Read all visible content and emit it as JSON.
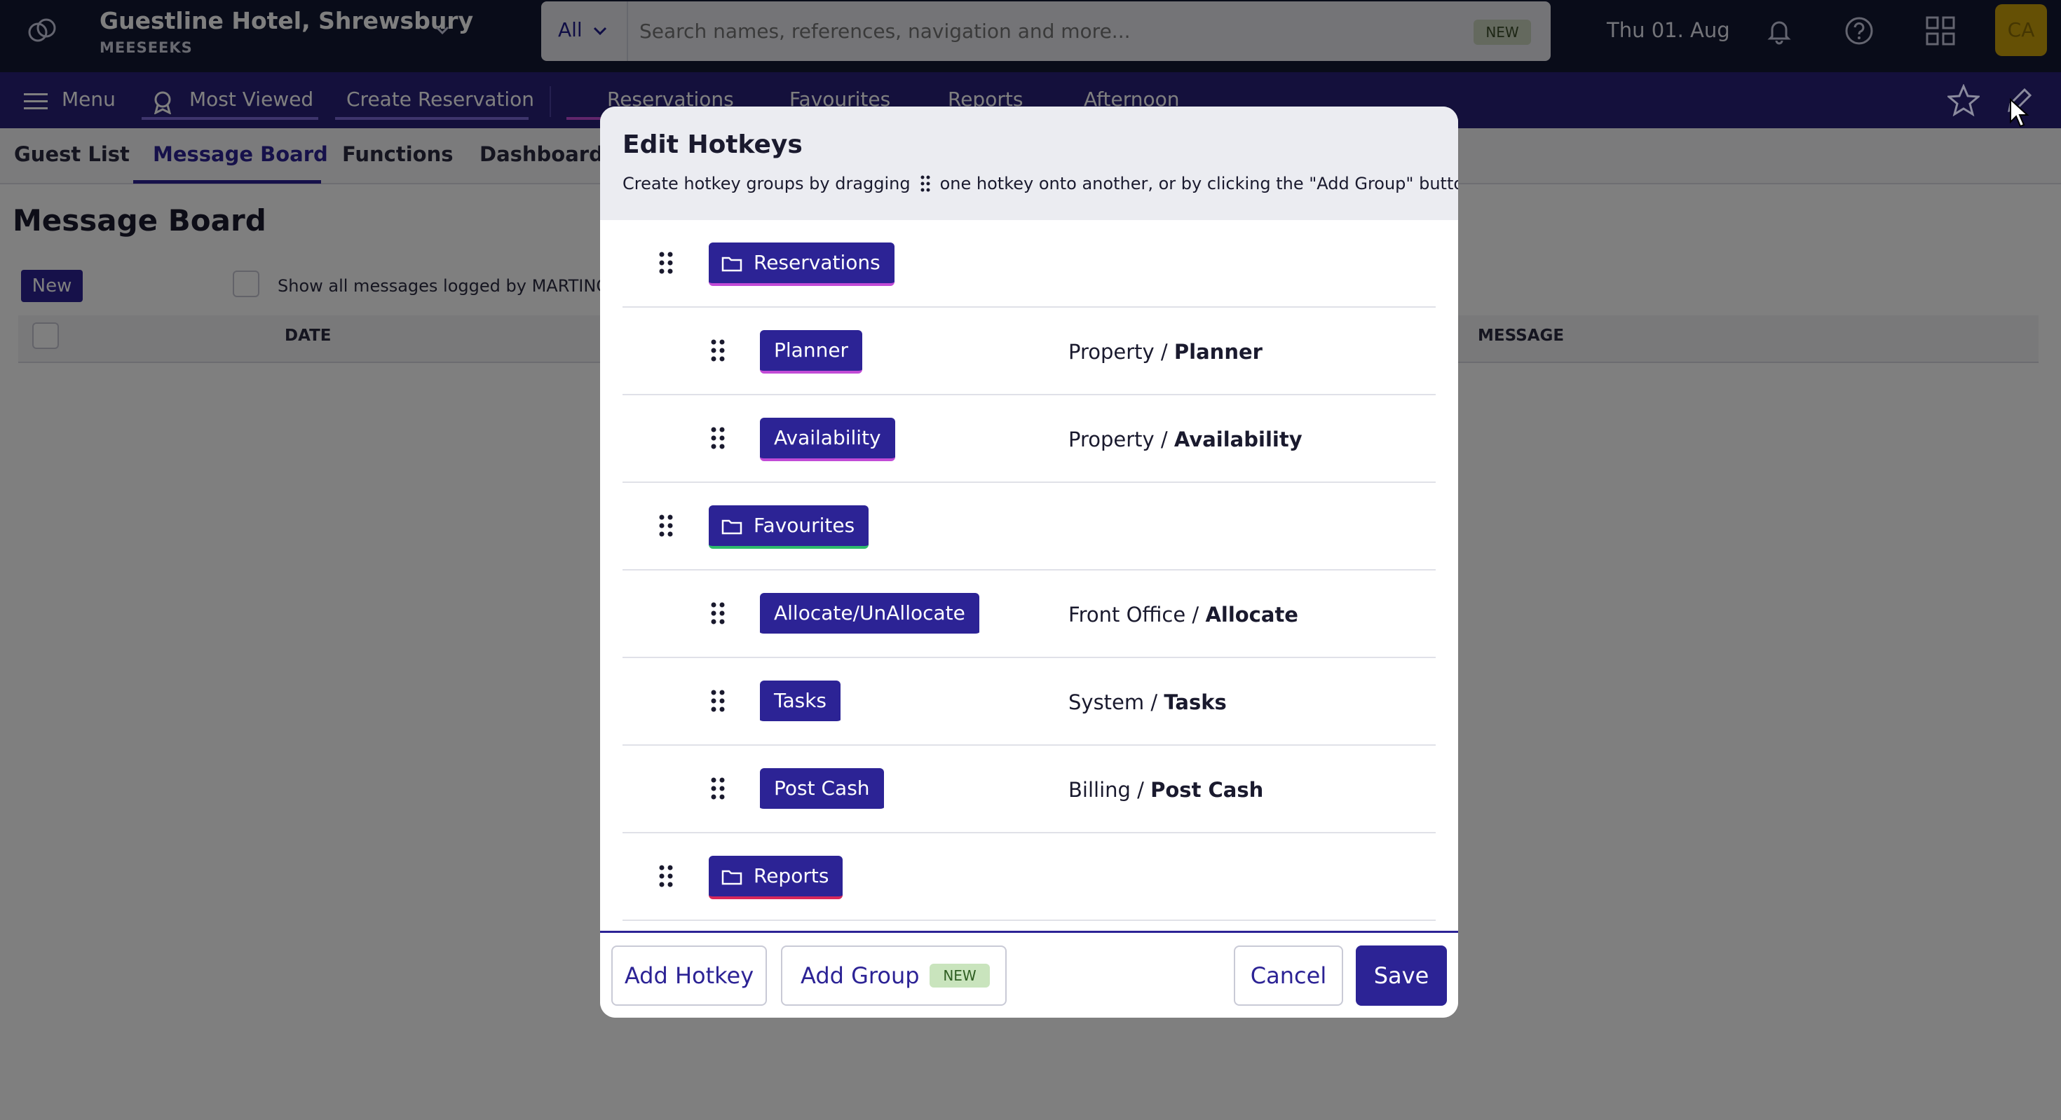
{
  "header": {
    "hotel_name": "Guestline Hotel, Shrewsbury",
    "hotel_sub": "MEESEEKS",
    "search_scope": "All",
    "search_placeholder": "Search names, references, navigation and more...",
    "search_badge": "NEW",
    "date": "Thu 01. Aug",
    "avatar": "CA"
  },
  "nav": {
    "menu": "Menu",
    "most_viewed": "Most Viewed",
    "create_reservation": "Create Reservation",
    "folders": [
      "Reservations",
      "Favourites",
      "Reports",
      "Afternoon"
    ]
  },
  "subtabs": [
    "Guest List",
    "Message Board",
    "Functions",
    "Dashboard"
  ],
  "page": {
    "title": "Message Board",
    "new_button": "New",
    "show_all_label": "Show all messages logged by MARTINCAT",
    "col_date": "DATE",
    "col_message": "MESSAGE"
  },
  "modal": {
    "title": "Edit Hotkeys",
    "desc_before": "Create hotkey groups by dragging",
    "desc_after": "one hotkey onto another, or by clicking the \"Add Group\" button.",
    "rows": [
      {
        "label": "Reservations",
        "group": true
      },
      {
        "label": "Planner",
        "path_prefix": "Property /",
        "path_name": "Planner"
      },
      {
        "label": "Availability",
        "path_prefix": "Property /",
        "path_name": "Availability"
      },
      {
        "label": "Favourites",
        "group": true
      },
      {
        "label": "Allocate/UnAllocate",
        "path_prefix": "Front Office /",
        "path_name": "Allocate"
      },
      {
        "label": "Tasks",
        "path_prefix": "System /",
        "path_name": "Tasks"
      },
      {
        "label": "Post Cash",
        "path_prefix": "Billing /",
        "path_name": "Post Cash"
      },
      {
        "label": "Reports",
        "group": true
      }
    ],
    "footer": {
      "add_hotkey": "Add Hotkey",
      "add_group": "Add Group",
      "new_tag": "NEW",
      "cancel": "Cancel",
      "save": "Save"
    }
  },
  "colors": {
    "brand": "#2c2395",
    "topbar": "#121833",
    "navbar": "#282079"
  }
}
